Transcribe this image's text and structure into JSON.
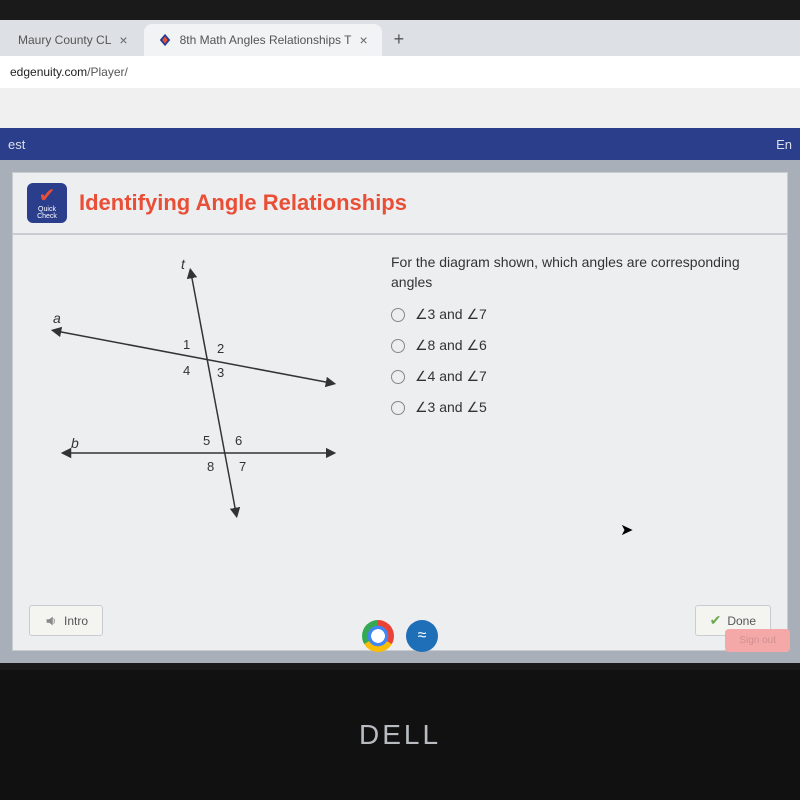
{
  "tabs": [
    {
      "label": "Maury County CL",
      "active": false
    },
    {
      "label": "8th Math Angles Relationships T",
      "active": true
    }
  ],
  "url": {
    "domain": "edgenuity.com",
    "path": "/Player/"
  },
  "bluebar": {
    "left": "est",
    "right": "En"
  },
  "quick_badge": {
    "line1": "Quick",
    "line2": "Check"
  },
  "title": "Identifying Angle Relationships",
  "diagram": {
    "t": "t",
    "a": "a",
    "b": "b",
    "n1": "1",
    "n2": "2",
    "n3": "3",
    "n4": "4",
    "n5": "5",
    "n6": "6",
    "n7": "7",
    "n8": "8"
  },
  "question": "For the diagram shown, which angles are corresponding angles",
  "options": [
    "∠3 and ∠7",
    "∠8 and ∠6",
    "∠4 and ∠7",
    "∠3 and ∠5"
  ],
  "buttons": {
    "intro": "Intro",
    "done": "Done"
  },
  "brand": "DELL",
  "signout": "Sign out"
}
